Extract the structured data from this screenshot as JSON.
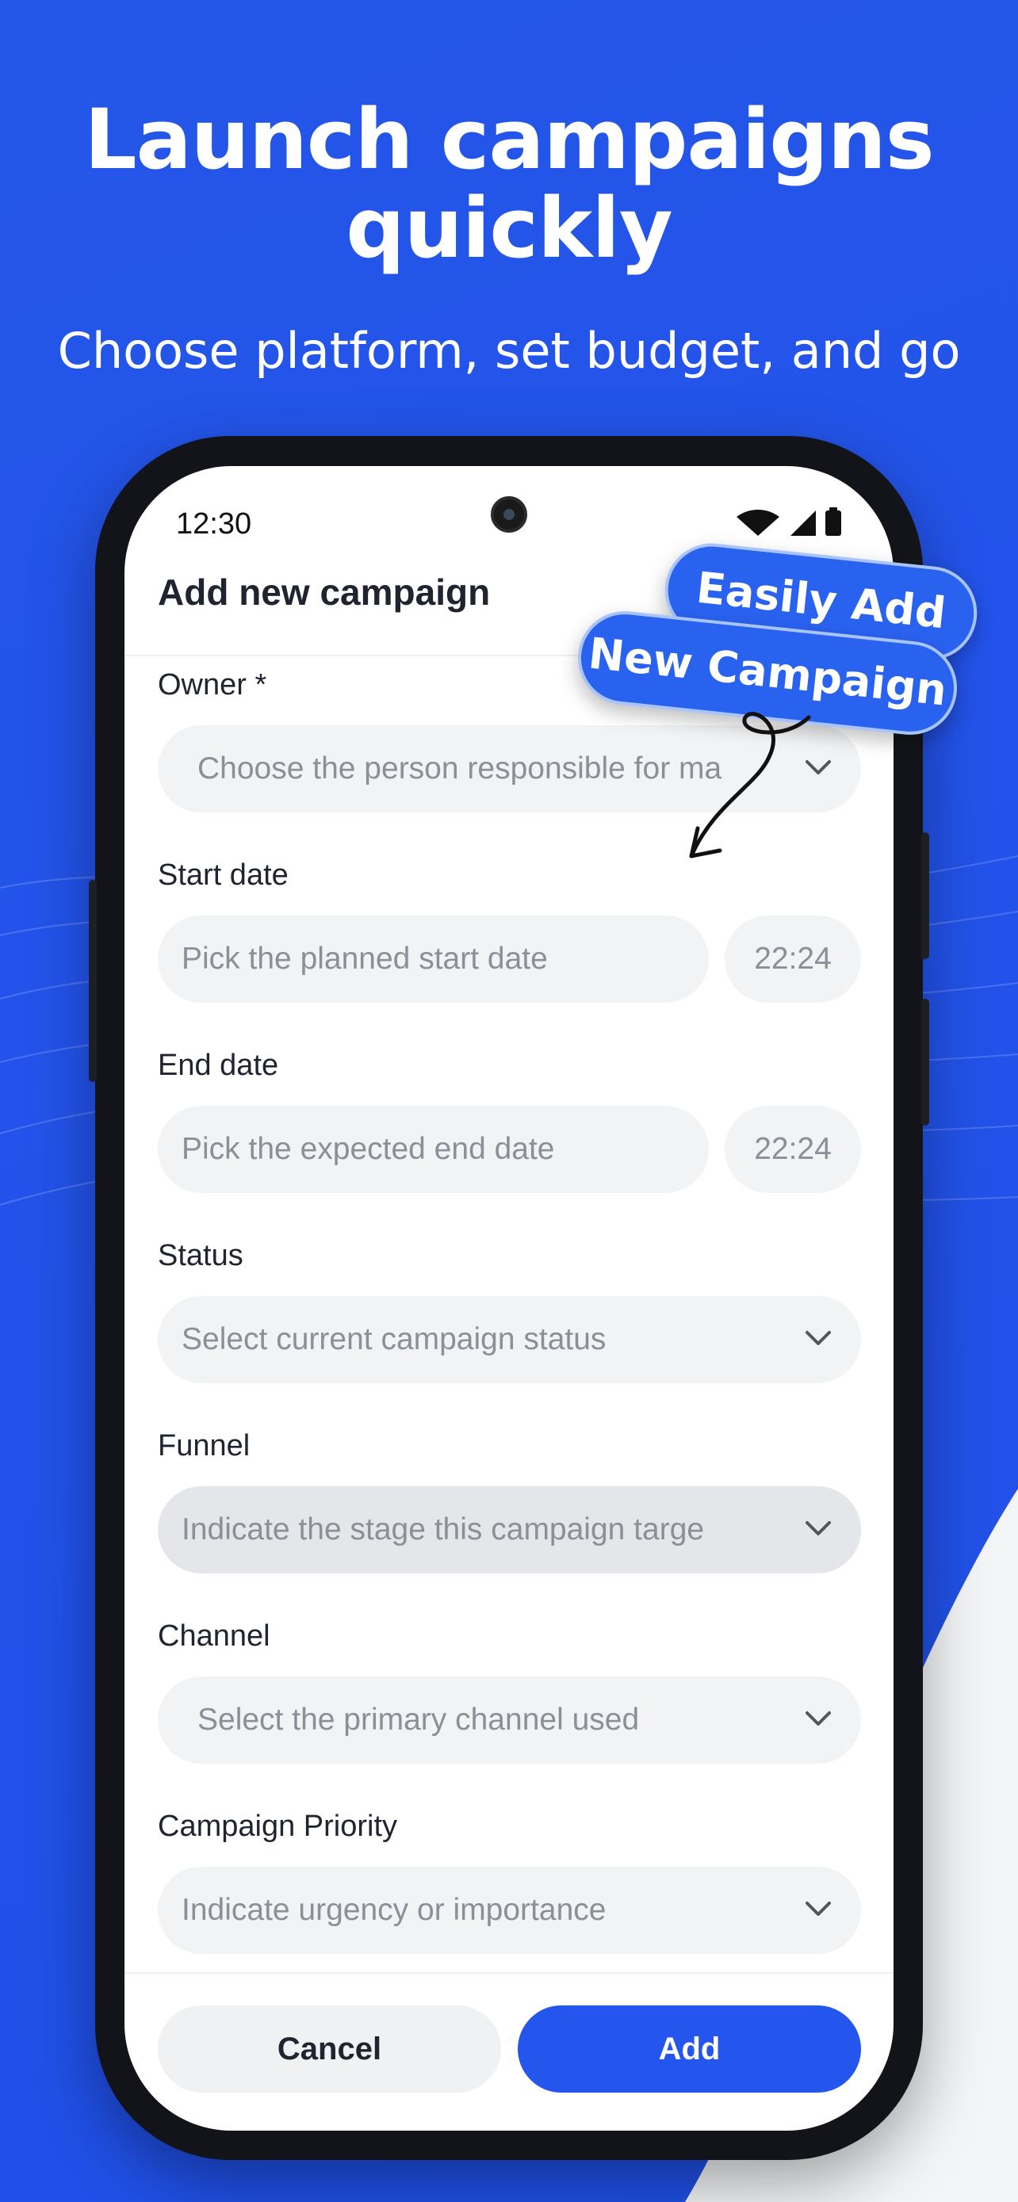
{
  "headline": {
    "line1": "Launch campaigns",
    "line2": "quickly"
  },
  "subheadline": "Choose platform, set budget, and go",
  "status_bar": {
    "time": "12:30"
  },
  "app": {
    "title": "Add new campaign"
  },
  "callout": {
    "line1": "Easily Add",
    "line2": "New Campaign"
  },
  "form": {
    "owner": {
      "label": "Owner *",
      "placeholder": "Choose the person responsible for ma"
    },
    "start_date": {
      "label": "Start date",
      "placeholder": "Pick the planned start date",
      "time": "22:24"
    },
    "end_date": {
      "label": "End date",
      "placeholder": "Pick the expected end date",
      "time": "22:24"
    },
    "status": {
      "label": "Status",
      "placeholder": "Select current campaign status"
    },
    "funnel": {
      "label": "Funnel",
      "placeholder": "Indicate the stage this campaign targe"
    },
    "channel": {
      "label": "Channel",
      "placeholder": "Select the primary channel used"
    },
    "priority": {
      "label": "Campaign Priority",
      "placeholder": "Indicate urgency or importance"
    }
  },
  "actions": {
    "cancel": "Cancel",
    "add": "Add"
  },
  "colors": {
    "background": "#2353ea",
    "accent": "#2455ec",
    "field": "#f2f3f5"
  }
}
